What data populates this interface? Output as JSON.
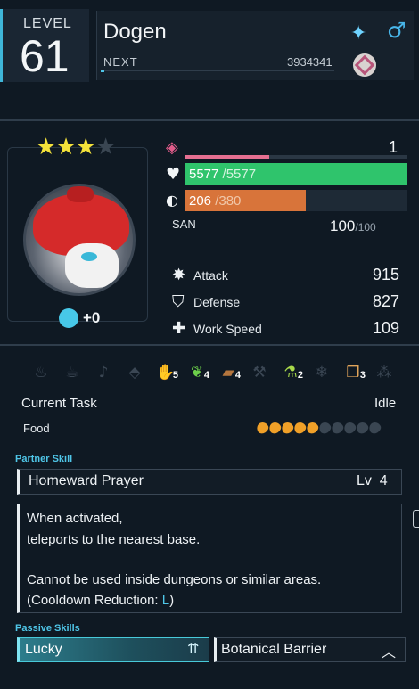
{
  "header": {
    "level_label": "LEVEL",
    "level_value": "61",
    "name": "Dogen",
    "next_label": "NEXT",
    "next_value": "3934341",
    "next_progress": 0.02,
    "gender_icon": "male-icon",
    "rank_icon": "rank-diamond-icon"
  },
  "portrait": {
    "stars_filled": 3,
    "stars_total": 4,
    "soul_label": "+0"
  },
  "bars": {
    "friendship_value": "1",
    "friendship_fraction": 0.38,
    "hp_current": "5577",
    "hp_max": "/5577",
    "food_current": "206",
    "food_max": "/380",
    "san_label": "SAN",
    "san_current": "100",
    "san_max": "/100"
  },
  "stats": [
    {
      "icon": "attack-icon",
      "label": "Attack",
      "value": "915"
    },
    {
      "icon": "defense-icon",
      "label": "Defense",
      "value": "827"
    },
    {
      "icon": "work-speed-icon",
      "label": "Work Speed",
      "value": "109"
    }
  ],
  "work_suitability": [
    {
      "icon": "kindling-icon",
      "active": false,
      "level": ""
    },
    {
      "icon": "watering-icon",
      "active": false,
      "level": ""
    },
    {
      "icon": "planting-icon",
      "active": false,
      "level": ""
    },
    {
      "icon": "electricity-icon",
      "active": false,
      "level": ""
    },
    {
      "icon": "handiwork-icon",
      "active": true,
      "level": "5"
    },
    {
      "icon": "gathering-icon",
      "active": true,
      "level": "4"
    },
    {
      "icon": "lumbering-icon",
      "active": true,
      "level": "4"
    },
    {
      "icon": "mining-icon",
      "active": false,
      "level": ""
    },
    {
      "icon": "medicine-icon",
      "active": true,
      "level": "2"
    },
    {
      "icon": "cooling-icon",
      "active": false,
      "level": ""
    },
    {
      "icon": "transporting-icon",
      "active": true,
      "level": "3"
    },
    {
      "icon": "farming-icon",
      "active": false,
      "level": ""
    }
  ],
  "task": {
    "label": "Current Task",
    "value": "Idle"
  },
  "food": {
    "label": "Food",
    "filled": 5,
    "total": 10
  },
  "partner_skill": {
    "section_label": "Partner Skill",
    "name": "Homeward Prayer",
    "level_label": "Lv",
    "level": "4",
    "desc_line1": "When activated,",
    "desc_line2": "teleports to the nearest base.",
    "desc_line3": "Cannot be used inside dungeons or similar areas.",
    "desc_line4_pre": "(Cooldown Reduction: ",
    "desc_line4_key": "L",
    "desc_line4_post": ")"
  },
  "passive_skills": {
    "section_label": "Passive Skills",
    "items": [
      {
        "name": "Lucky",
        "icon": "rank-up-triple-icon",
        "highlight_color": "#48c9d9"
      },
      {
        "name": "Botanical Barrier",
        "icon": "rank-up-single-icon"
      }
    ]
  }
}
